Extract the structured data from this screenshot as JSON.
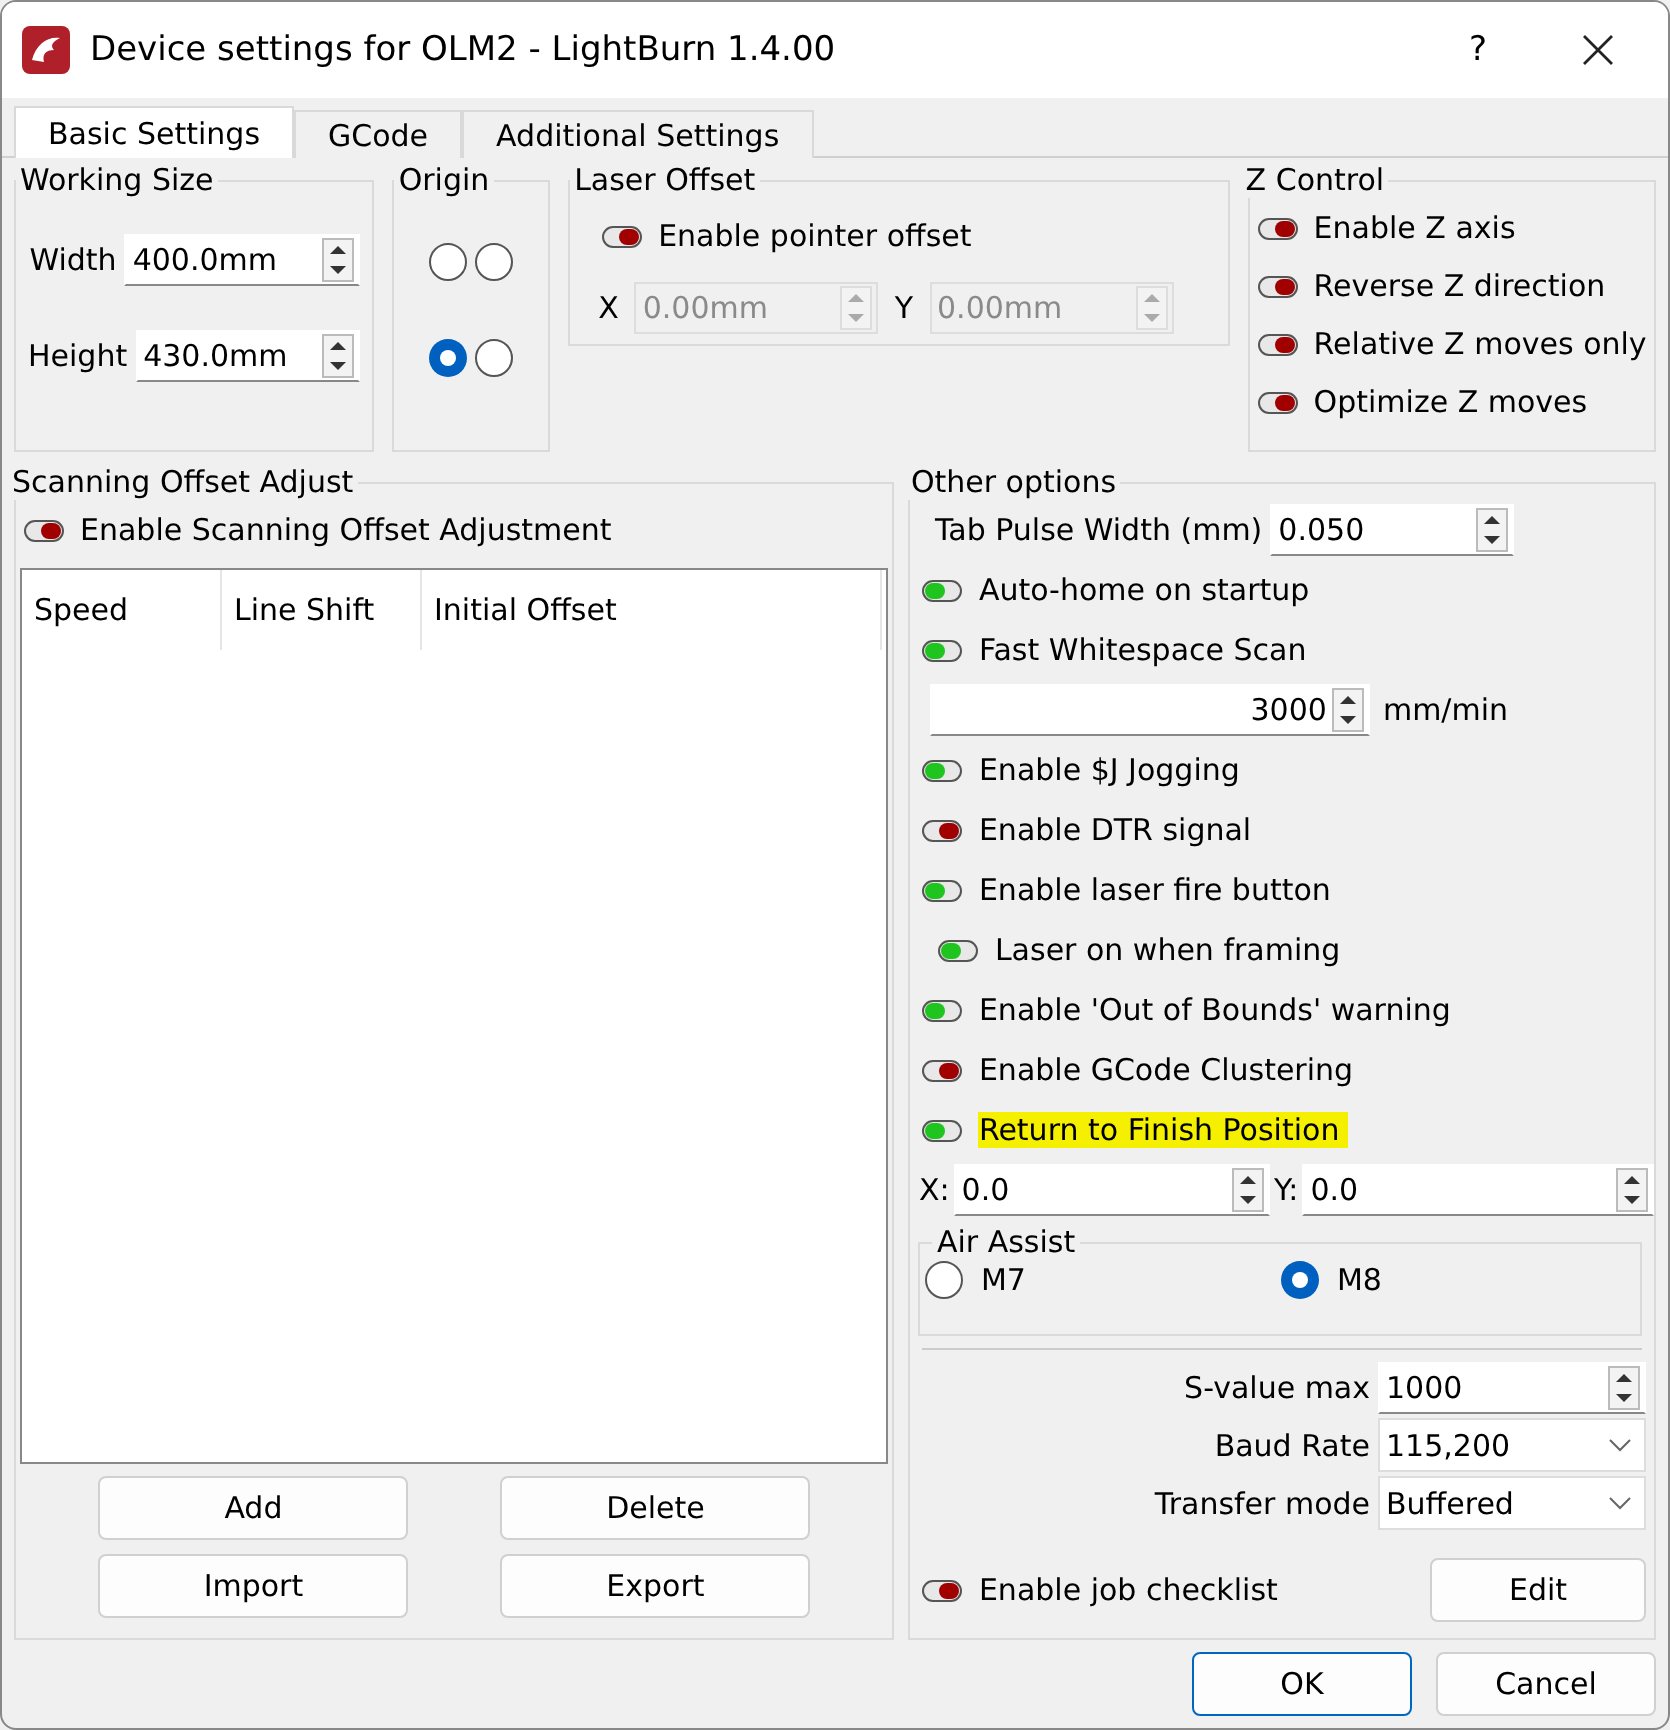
{
  "window": {
    "title": "Device settings for OLM2 - LightBurn 1.4.00",
    "help": "?"
  },
  "tabs": [
    {
      "label": "Basic Settings",
      "selected": true
    },
    {
      "label": "GCode",
      "selected": false
    },
    {
      "label": "Additional Settings",
      "selected": false
    }
  ],
  "working_size": {
    "title": "Working Size",
    "fields": [
      {
        "label": "Width",
        "value": "400.0mm"
      },
      {
        "label": "Height",
        "value": "430.0mm"
      }
    ]
  },
  "origin": {
    "title": "Origin",
    "corners": [
      {
        "selected": false
      },
      {
        "selected": false
      },
      {
        "selected": true
      },
      {
        "selected": false
      }
    ]
  },
  "laser_offset": {
    "title": "Laser Offset",
    "toggle": {
      "label": "Enable pointer offset",
      "checked": false
    },
    "fields": [
      {
        "label": "X",
        "value": "0.00mm",
        "disabled": true
      },
      {
        "label": "Y",
        "value": "0.00mm",
        "disabled": true
      }
    ]
  },
  "z_control": {
    "title": "Z Control",
    "toggles": [
      {
        "label": "Enable Z axis",
        "checked": false
      },
      {
        "label": "Reverse Z direction",
        "checked": false
      },
      {
        "label": "Relative Z moves only",
        "checked": false
      },
      {
        "label": "Optimize Z moves",
        "checked": false
      }
    ]
  },
  "scanning_offset": {
    "title": "Scanning Offset Adjust",
    "toggle": {
      "label": "Enable Scanning Offset Adjustment",
      "checked": false
    },
    "columns": [
      "Speed",
      "Line Shift",
      "Initial Offset"
    ],
    "buttons": [
      "Add",
      "Delete",
      "Import",
      "Export"
    ]
  },
  "other_options": {
    "title": "Other options",
    "items": [
      {
        "kind": "spin",
        "label": "Tab Pulse Width (mm)",
        "value": "0.050"
      },
      {
        "kind": "toggle",
        "label": "Auto-home on startup",
        "checked": true
      },
      {
        "kind": "toggle",
        "label": "Fast Whitespace Scan",
        "checked": true
      },
      {
        "kind": "speed",
        "value": "3000",
        "unit": "mm/min"
      },
      {
        "kind": "toggle",
        "label": "Enable $J Jogging",
        "checked": true
      },
      {
        "kind": "toggle",
        "label": "Enable DTR signal",
        "checked": false
      },
      {
        "kind": "toggle",
        "label": "Enable laser fire button",
        "checked": true
      },
      {
        "kind": "subtoggle",
        "label": "Laser on when framing",
        "checked": true
      },
      {
        "kind": "toggle",
        "label": "Enable 'Out of Bounds' warning",
        "checked": true
      },
      {
        "kind": "toggle",
        "label": "Enable GCode Clustering",
        "checked": false
      },
      {
        "kind": "toggle",
        "label": "Return to Finish Position",
        "checked": true,
        "highlighted": true
      },
      {
        "kind": "xy",
        "fields": [
          {
            "label": "X:",
            "value": "0.0"
          },
          {
            "label": "Y:",
            "value": "0.0"
          }
        ]
      }
    ]
  },
  "air_assist": {
    "title": "Air Assist",
    "options": [
      {
        "label": "M7",
        "selected": false
      },
      {
        "label": "M8",
        "selected": true
      }
    ]
  },
  "settings": [
    {
      "kind": "spin",
      "label": "S-value max",
      "value": "1000"
    },
    {
      "kind": "select",
      "label": "Baud Rate",
      "value": "115,200"
    },
    {
      "kind": "select",
      "label": "Transfer mode",
      "value": "Buffered"
    }
  ],
  "job_checklist": {
    "label": "Enable job checklist",
    "checked": false,
    "button": "Edit"
  },
  "footer": [
    {
      "label": "OK",
      "default": true
    },
    {
      "label": "Cancel",
      "default": false
    }
  ]
}
